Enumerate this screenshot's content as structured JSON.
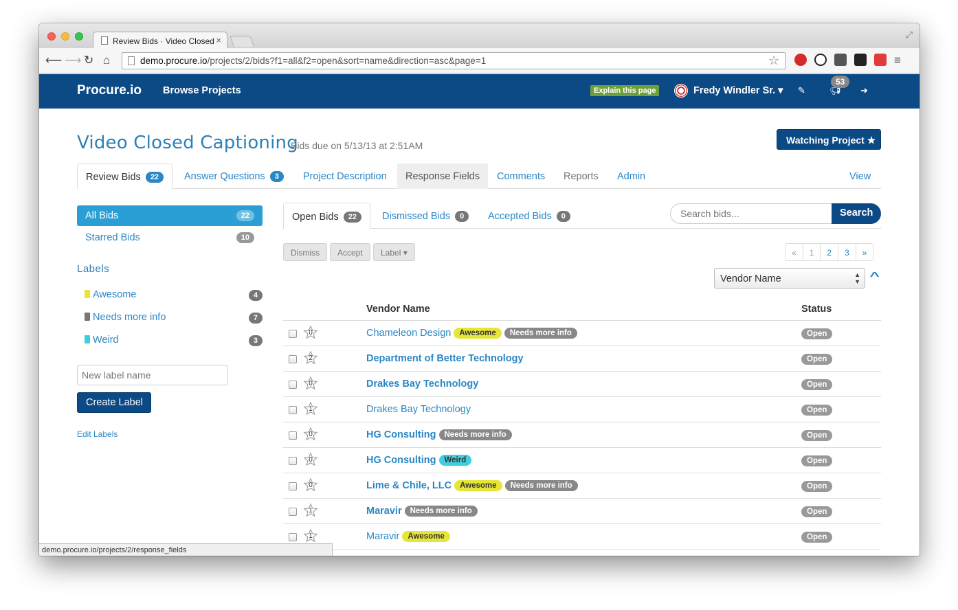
{
  "browser": {
    "tab_title": "Review Bids · Video Closed",
    "tab_close": "×",
    "url_host": "demo.procure.io",
    "url_path": "/projects/2/bids?f1=all&f2=open&sort=name&direction=asc&page=1",
    "status_url": "demo.procure.io/projects/2/response_fields",
    "nav_icons": [
      "back-arrow-icon",
      "forward-arrow-icon",
      "reload-icon",
      "home-icon",
      "bookmark-star-icon",
      "fullscreen-icon"
    ],
    "extension_colors": [
      "#d42a2a",
      "#222222",
      "#555555",
      "#222222",
      "#e23b3b"
    ]
  },
  "navbar": {
    "brand": "Procure.io",
    "browse": "Browse Projects",
    "explain": "Explain this page",
    "user": "Fredy Windler Sr. ▾",
    "notifications": "53",
    "bg_color": "#0c4a86"
  },
  "project": {
    "title": "Video Closed Captioning",
    "due": "Bids due on 5/13/13 at 2:51AM",
    "watch_button": "Watching Project ★"
  },
  "tabs": [
    {
      "label": "Review Bids",
      "badge": "22"
    },
    {
      "label": "Answer Questions",
      "badge": "3"
    },
    {
      "label": "Project Description"
    },
    {
      "label": "Response Fields"
    },
    {
      "label": "Comments"
    },
    {
      "label": "Reports"
    },
    {
      "label": "Admin"
    },
    {
      "label": "View"
    }
  ],
  "sidebar": {
    "all_bids": {
      "label": "All Bids",
      "count": "22"
    },
    "starred_bids": {
      "label": "Starred Bids",
      "count": "10"
    },
    "labels_heading": "Labels",
    "labels": [
      {
        "name": "Awesome",
        "count": "4",
        "color": "#e6e639"
      },
      {
        "name": "Needs more info",
        "count": "7",
        "color": "#777777"
      },
      {
        "name": "Weird",
        "count": "3",
        "color": "#3ecfdf"
      }
    ],
    "new_label_placeholder": "New label name",
    "create_label": "Create Label",
    "edit_labels": "Edit Labels"
  },
  "subtabs": [
    {
      "label": "Open Bids",
      "badge": "22"
    },
    {
      "label": "Dismissed Bids",
      "badge": "0"
    },
    {
      "label": "Accepted Bids",
      "badge": "0"
    }
  ],
  "search": {
    "placeholder": "Search bids...",
    "button": "Search"
  },
  "actions": {
    "dismiss": "Dismiss",
    "accept": "Accept",
    "label": "Label ▾"
  },
  "pager": [
    "«",
    "1",
    "2",
    "3",
    "»"
  ],
  "sort": {
    "selected": "Vendor Name",
    "direction_icon": "chevron-up-icon"
  },
  "table": {
    "headers": {
      "vendor": "Vendor Name",
      "status": "Status"
    },
    "rows": [
      {
        "vendor": "Chameleon Design",
        "bold": false,
        "stars": "0",
        "labels": [
          "Awesome",
          "Needs more info"
        ],
        "status": "Open"
      },
      {
        "vendor": "Department of Better Technology",
        "bold": true,
        "stars": "2",
        "labels": [],
        "status": "Open"
      },
      {
        "vendor": "Drakes Bay Technology",
        "bold": true,
        "stars": "0",
        "labels": [],
        "status": "Open"
      },
      {
        "vendor": "Drakes Bay Technology",
        "bold": false,
        "stars": "1",
        "labels": [],
        "status": "Open"
      },
      {
        "vendor": "HG Consulting",
        "bold": true,
        "stars": "0",
        "labels": [
          "Needs more info"
        ],
        "status": "Open"
      },
      {
        "vendor": "HG Consulting",
        "bold": true,
        "stars": "0",
        "labels": [
          "Weird"
        ],
        "status": "Open"
      },
      {
        "vendor": "Lime & Chile, LLC",
        "bold": true,
        "stars": "0",
        "labels": [
          "Awesome",
          "Needs more info"
        ],
        "status": "Open"
      },
      {
        "vendor": "Maravir",
        "bold": true,
        "stars": "1",
        "labels": [
          "Needs more info"
        ],
        "status": "Open"
      },
      {
        "vendor": "Maravir",
        "bold": false,
        "stars": "1",
        "labels": [
          "Awesome"
        ],
        "status": "Open"
      }
    ]
  }
}
